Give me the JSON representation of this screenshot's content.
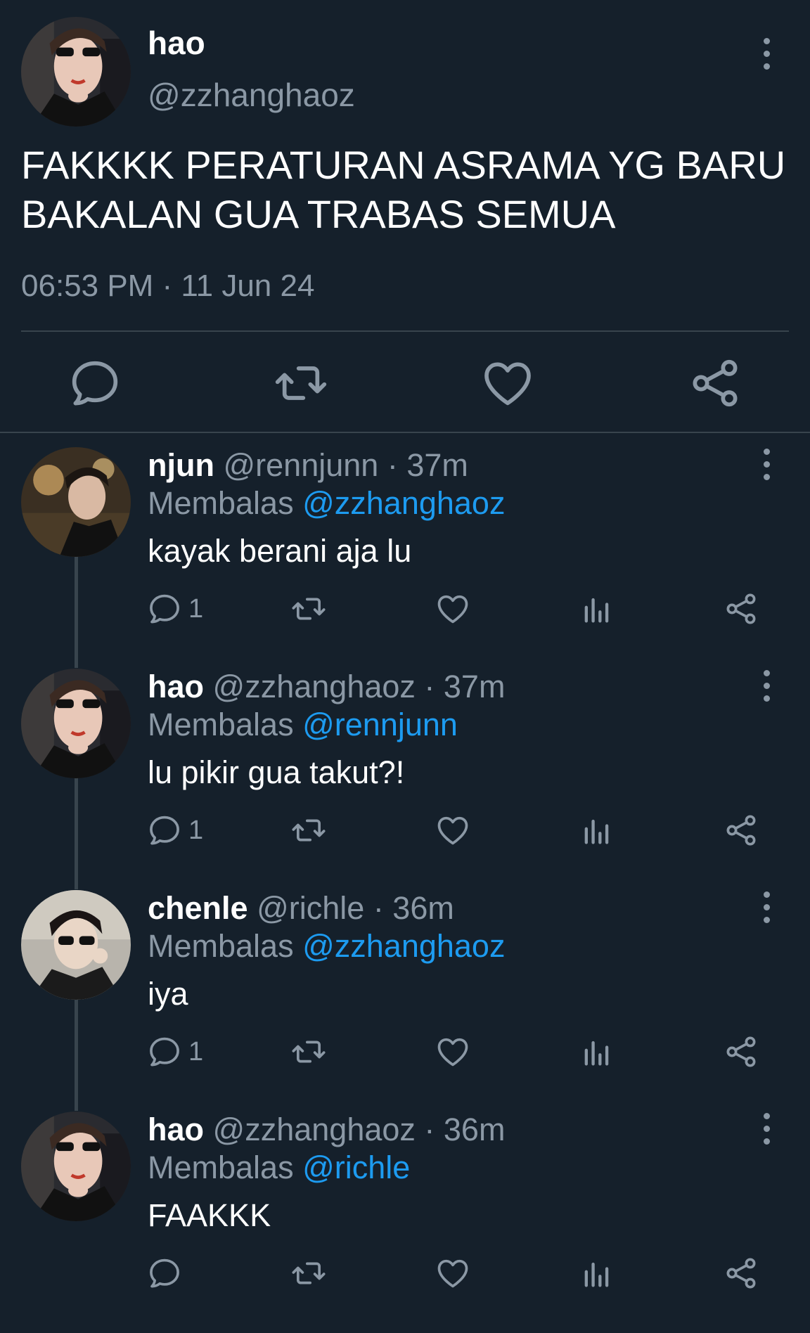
{
  "main_tweet": {
    "name": "hao",
    "handle": "@zzhanghaoz",
    "text": "FAKKKK PERATURAN ASRAMA YG BARU BAKALAN GUA TRABAS SEMUA",
    "timestamp": "06:53 PM · 11 Jun 24",
    "actions": [
      "reply-icon",
      "retweet-icon",
      "like-icon",
      "share-icon"
    ]
  },
  "replies": [
    {
      "name": "njun",
      "handle": "@rennjunn",
      "time": "· 37m",
      "replying_label": "Membalas",
      "replying_to": "@zzhanghaoz",
      "text": "kayak berani aja lu",
      "reply_count": "1"
    },
    {
      "name": "hao",
      "handle": "@zzhanghaoz",
      "time": "· 37m",
      "replying_label": "Membalas",
      "replying_to": "@rennjunn",
      "text": "lu pikir gua takut?!",
      "reply_count": "1"
    },
    {
      "name": "chenle",
      "handle": "@richle",
      "time": "· 36m",
      "replying_label": "Membalas",
      "replying_to": "@zzhanghaoz",
      "text": "iya",
      "reply_count": "1"
    },
    {
      "name": "hao",
      "handle": "@zzhanghaoz",
      "time": "· 36m",
      "replying_label": "Membalas",
      "replying_to": "@richle",
      "text": "FAAKKK",
      "reply_count": ""
    }
  ],
  "colors": {
    "background": "#15202b",
    "secondary_text": "#8b98a5",
    "mention": "#1d9bf0",
    "divider": "#38444d"
  }
}
